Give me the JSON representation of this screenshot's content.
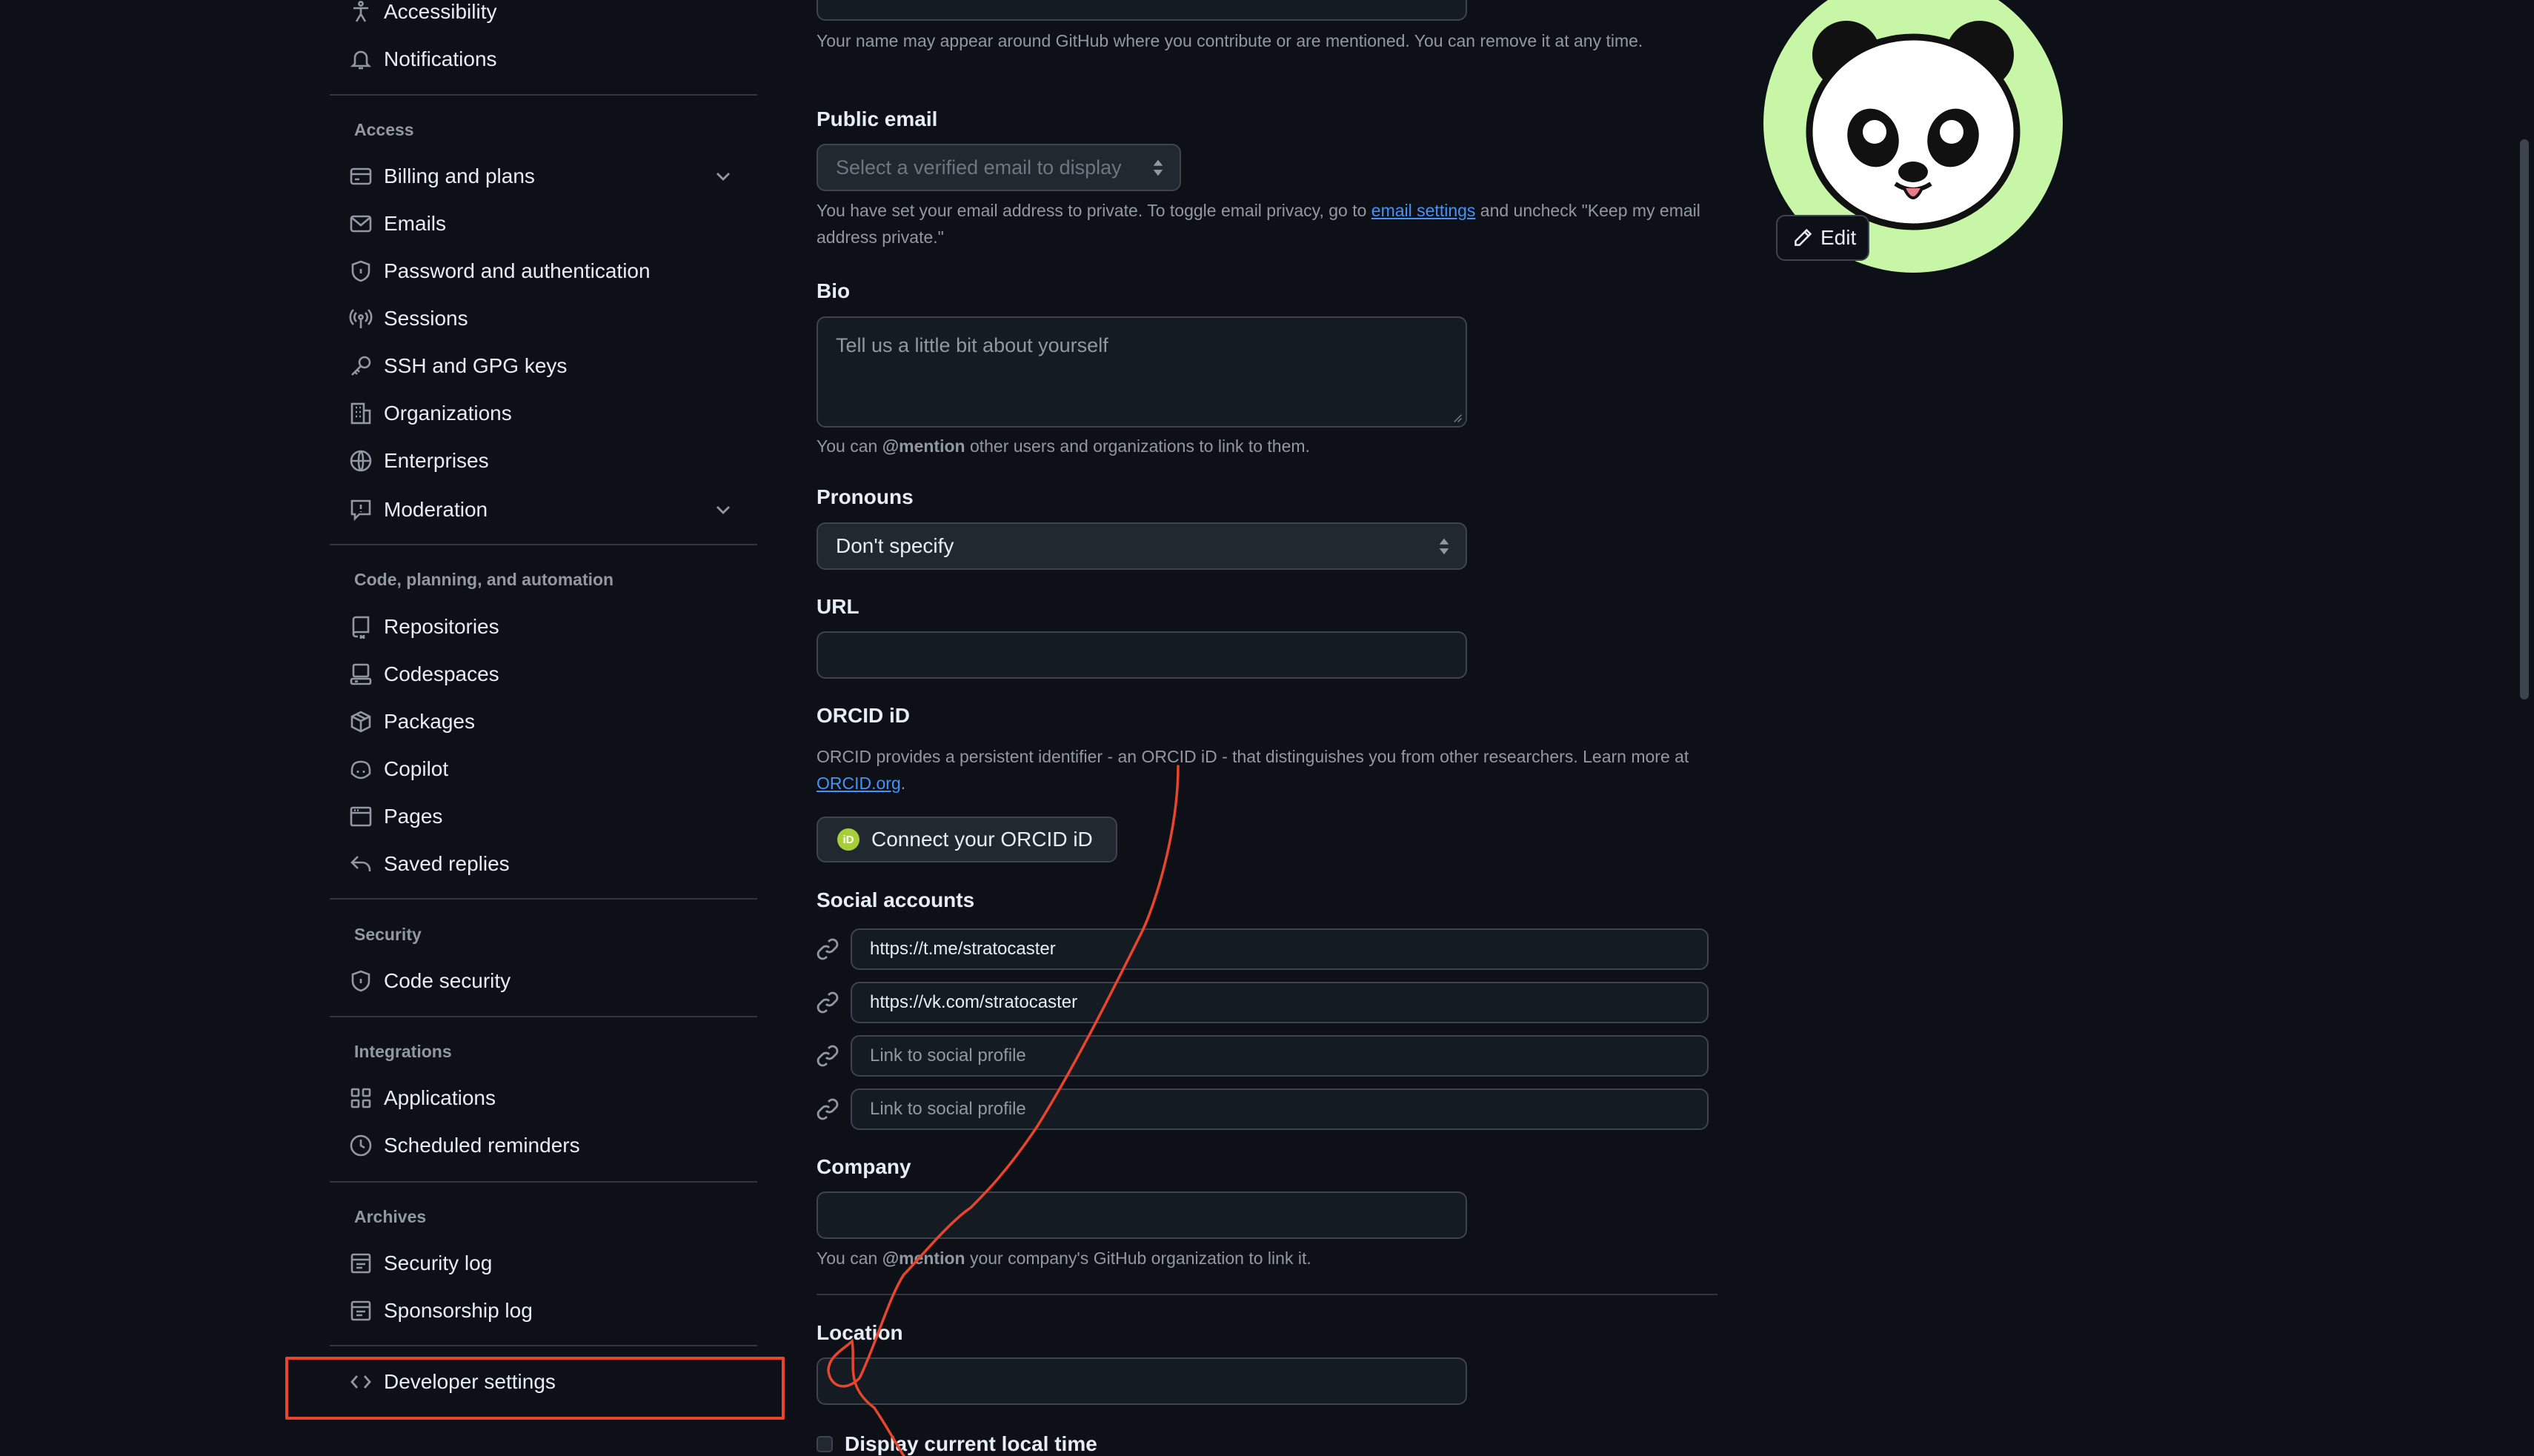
{
  "sidebar": {
    "top_items": [
      {
        "label": "Accessibility",
        "icon": "accessibility-icon"
      },
      {
        "label": "Notifications",
        "icon": "bell-icon"
      }
    ],
    "sections": [
      {
        "title": "Access",
        "items": [
          {
            "label": "Billing and plans",
            "icon": "credit-card-icon",
            "expandable": true
          },
          {
            "label": "Emails",
            "icon": "mail-icon"
          },
          {
            "label": "Password and authentication",
            "icon": "shield-lock-icon"
          },
          {
            "label": "Sessions",
            "icon": "broadcast-icon"
          },
          {
            "label": "SSH and GPG keys",
            "icon": "key-icon"
          },
          {
            "label": "Organizations",
            "icon": "organization-icon"
          },
          {
            "label": "Enterprises",
            "icon": "globe-icon"
          },
          {
            "label": "Moderation",
            "icon": "report-icon",
            "expandable": true
          }
        ]
      },
      {
        "title": "Code, planning, and automation",
        "items": [
          {
            "label": "Repositories",
            "icon": "repo-icon"
          },
          {
            "label": "Codespaces",
            "icon": "codespaces-icon"
          },
          {
            "label": "Packages",
            "icon": "package-icon"
          },
          {
            "label": "Copilot",
            "icon": "copilot-icon"
          },
          {
            "label": "Pages",
            "icon": "browser-icon"
          },
          {
            "label": "Saved replies",
            "icon": "reply-icon"
          }
        ]
      },
      {
        "title": "Security",
        "items": [
          {
            "label": "Code security",
            "icon": "shield-lock-icon"
          }
        ]
      },
      {
        "title": "Integrations",
        "items": [
          {
            "label": "Applications",
            "icon": "apps-icon"
          },
          {
            "label": "Scheduled reminders",
            "icon": "clock-icon"
          }
        ]
      },
      {
        "title": "Archives",
        "items": [
          {
            "label": "Security log",
            "icon": "log-icon"
          },
          {
            "label": "Sponsorship log",
            "icon": "log-icon"
          }
        ]
      }
    ],
    "developer_settings": {
      "label": "Developer settings",
      "icon": "code-icon"
    }
  },
  "form": {
    "name_note": "Your name may appear around GitHub where you contribute or are mentioned. You can remove it at any time.",
    "public_email": {
      "label": "Public email",
      "placeholder": "Select a verified email to display",
      "note_before": "You have set your email address to private. To toggle email privacy, go to ",
      "note_link": "email settings",
      "note_after": " and uncheck \"Keep my email address private.\""
    },
    "bio": {
      "label": "Bio",
      "placeholder": "Tell us a little bit about yourself",
      "note_before": "You can ",
      "note_mention": "@mention",
      "note_after": " other users and organizations to link to them."
    },
    "pronouns": {
      "label": "Pronouns",
      "value": "Don't specify"
    },
    "url": {
      "label": "URL",
      "value": ""
    },
    "orcid": {
      "label": "ORCID iD",
      "note_before": "ORCID provides a persistent identifier - an ORCID iD - that distinguishes you from other researchers. Learn more at ",
      "note_link": "ORCID.org",
      "note_after": ".",
      "button": "Connect your ORCID iD",
      "badge": "iD"
    },
    "social": {
      "label": "Social accounts",
      "links": [
        {
          "value": "https://t.me/stratocaster",
          "placeholder": "Link to social profile"
        },
        {
          "value": "https://vk.com/stratocaster",
          "placeholder": "Link to social profile"
        },
        {
          "value": "",
          "placeholder": "Link to social profile"
        },
        {
          "value": "",
          "placeholder": "Link to social profile"
        }
      ]
    },
    "company": {
      "label": "Company",
      "value": "",
      "note_before": "You can ",
      "note_mention": "@mention",
      "note_after": " your company's GitHub organization to link it."
    },
    "location": {
      "label": "Location",
      "value": ""
    },
    "local_time": {
      "label": "Display current local time",
      "checked": false
    }
  },
  "avatar": {
    "edit_label": "Edit",
    "bg_color": "#c6f6a6"
  },
  "colors": {
    "annotation": "#e8452c",
    "link": "#4493f8",
    "background": "#0d1117"
  }
}
